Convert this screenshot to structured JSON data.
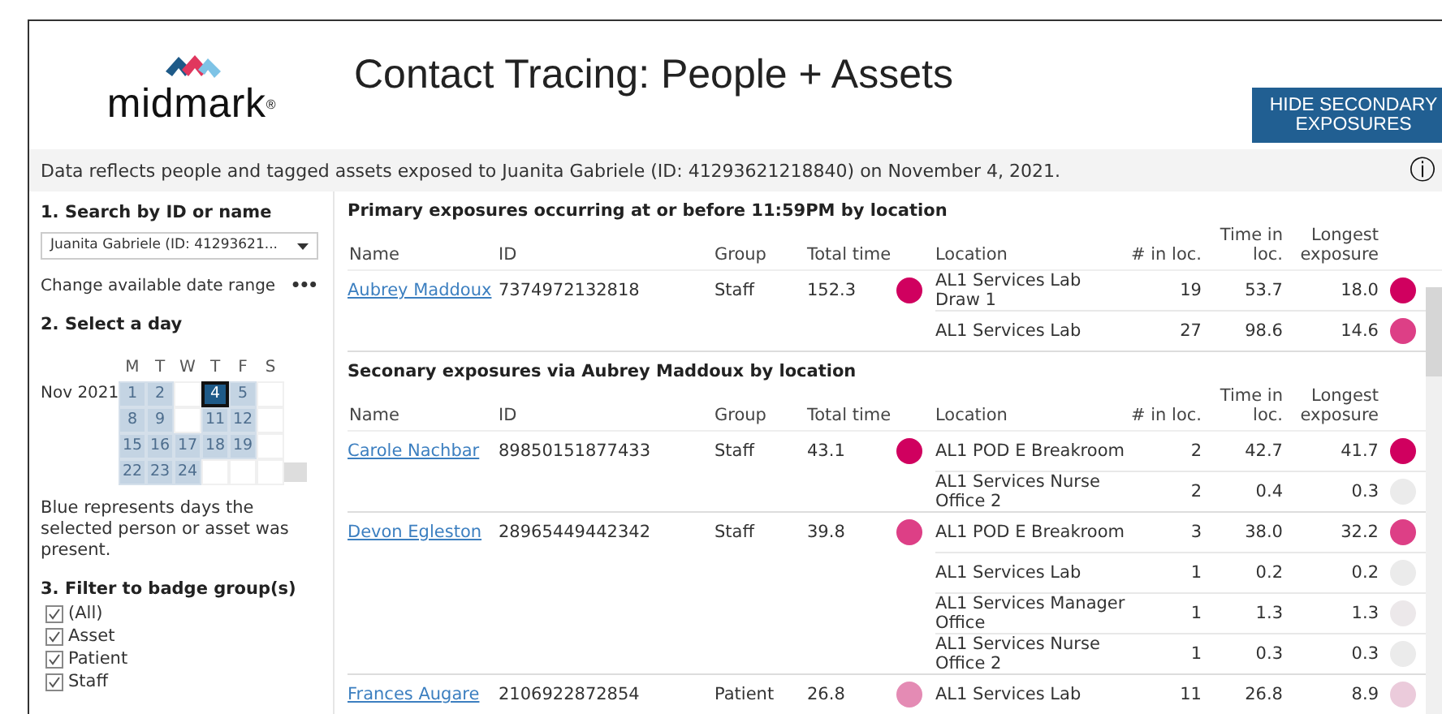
{
  "header": {
    "logo_text": "midmark",
    "logo_mark": "®",
    "title": "Contact Tracing: People + Assets",
    "button": "HIDE SECONDARY EXPOSURES"
  },
  "info_bar": {
    "text": "Data reflects people and tagged assets exposed to Juanita Gabriele (ID: 41293621218840) on November 4, 2021.",
    "icon": "ⓘ"
  },
  "sidebar": {
    "search_heading": "1. Search by ID or name",
    "search_value": "Juanita Gabriele (ID: 41293621...",
    "date_range_label": "Change available date range",
    "more": "•••",
    "day_heading": "2. Select a day",
    "calendar": {
      "month": "Nov 2021",
      "weekdays": [
        "M",
        "T",
        "W",
        "T",
        "F",
        "S"
      ],
      "weeks": [
        [
          {
            "day": "1",
            "present": true,
            "selected": false
          },
          {
            "day": "2",
            "present": true,
            "selected": false
          },
          {
            "present": false,
            "selected": false
          },
          {
            "day": "4",
            "present": true,
            "selected": true
          },
          {
            "day": "5",
            "present": true,
            "selected": false
          },
          {
            "present": false,
            "selected": false
          }
        ],
        [
          {
            "day": "8",
            "present": true,
            "selected": false
          },
          {
            "day": "9",
            "present": true,
            "selected": false
          },
          {
            "present": false,
            "selected": false
          },
          {
            "day": "11",
            "present": true,
            "selected": false
          },
          {
            "day": "12",
            "present": true,
            "selected": false
          },
          {
            "present": false,
            "selected": false
          }
        ],
        [
          {
            "day": "15",
            "present": true,
            "selected": false
          },
          {
            "day": "16",
            "present": true,
            "selected": false
          },
          {
            "day": "17",
            "present": true,
            "selected": false
          },
          {
            "day": "18",
            "present": true,
            "selected": false
          },
          {
            "day": "19",
            "present": true,
            "selected": false
          },
          {
            "present": false,
            "selected": false
          }
        ],
        [
          {
            "day": "22",
            "present": true,
            "selected": false
          },
          {
            "day": "23",
            "present": true,
            "selected": false
          },
          {
            "day": "24",
            "present": true,
            "selected": false
          },
          {
            "present": false,
            "selected": false
          },
          {
            "present": false,
            "selected": false
          },
          {
            "present": false,
            "selected": false
          }
        ]
      ]
    },
    "legend": "Blue represents days the selected person or asset was present.",
    "filter_heading": "3. Filter to badge group(s)",
    "filters": [
      {
        "label": "(All)",
        "checked": true
      },
      {
        "label": "Asset",
        "checked": true
      },
      {
        "label": "Patient",
        "checked": true
      },
      {
        "label": "Staff",
        "checked": true
      }
    ]
  },
  "sections": [
    {
      "title": "Primary exposures occurring at or before 11:59PM by location",
      "columns": [
        "Name",
        "ID",
        "Group",
        "Total time",
        "Location",
        "# in loc.",
        "Time in loc.",
        "Longest exposure"
      ],
      "people": [
        {
          "name": "Aubrey Maddoux",
          "id": "7374972132818",
          "group": "Staff",
          "total": "152.3",
          "color": "#d0005f",
          "locations": [
            {
              "location": "AL1 Services Lab Draw 1",
              "count": "19",
              "time": "53.7",
              "longest": "18.0",
              "color": "#d0005f"
            },
            {
              "location": "AL1 Services Lab",
              "count": "27",
              "time": "98.6",
              "longest": "14.6",
              "color": "#dd3f86"
            }
          ]
        }
      ]
    },
    {
      "title": "Seconary exposures via Aubrey Maddoux by location",
      "columns": [
        "Name",
        "ID",
        "Group",
        "Total time",
        "Location",
        "# in loc.",
        "Time in loc.",
        "Longest exposure"
      ],
      "people": [
        {
          "name": "Carole Nachbar",
          "id": "89850151877433",
          "group": "Staff",
          "total": "43.1",
          "color": "#d0005f",
          "locations": [
            {
              "location": "AL1 POD E Breakroom",
              "count": "2",
              "time": "42.7",
              "longest": "41.7",
              "color": "#d0005f"
            },
            {
              "location": "AL1 Services Nurse Office 2",
              "count": "2",
              "time": "0.4",
              "longest": "0.3",
              "color": "#ebebeb"
            }
          ]
        },
        {
          "name": "Devon Egleston",
          "id": "28965449442342",
          "group": "Staff",
          "total": "39.8",
          "color": "#dd3f86",
          "locations": [
            {
              "location": "AL1 POD E Breakroom",
              "count": "3",
              "time": "38.0",
              "longest": "32.2",
              "color": "#dd3f86"
            },
            {
              "location": "AL1 Services Lab",
              "count": "1",
              "time": "0.2",
              "longest": "0.2",
              "color": "#ebebeb"
            },
            {
              "location": "AL1 Services Manager Office",
              "count": "1",
              "time": "1.3",
              "longest": "1.3",
              "color": "#ece8ea"
            },
            {
              "location": "AL1 Services Nurse Office 2",
              "count": "1",
              "time": "0.3",
              "longest": "0.3",
              "color": "#ebebeb"
            }
          ]
        },
        {
          "name": "Frances Augare",
          "id": "2106922872854",
          "group": "Patient",
          "total": "26.8",
          "color": "#e48bb4",
          "locations": [
            {
              "location": "AL1 Services Lab",
              "count": "11",
              "time": "26.8",
              "longest": "8.9",
              "color": "#ebcbdb"
            }
          ]
        }
      ]
    }
  ]
}
